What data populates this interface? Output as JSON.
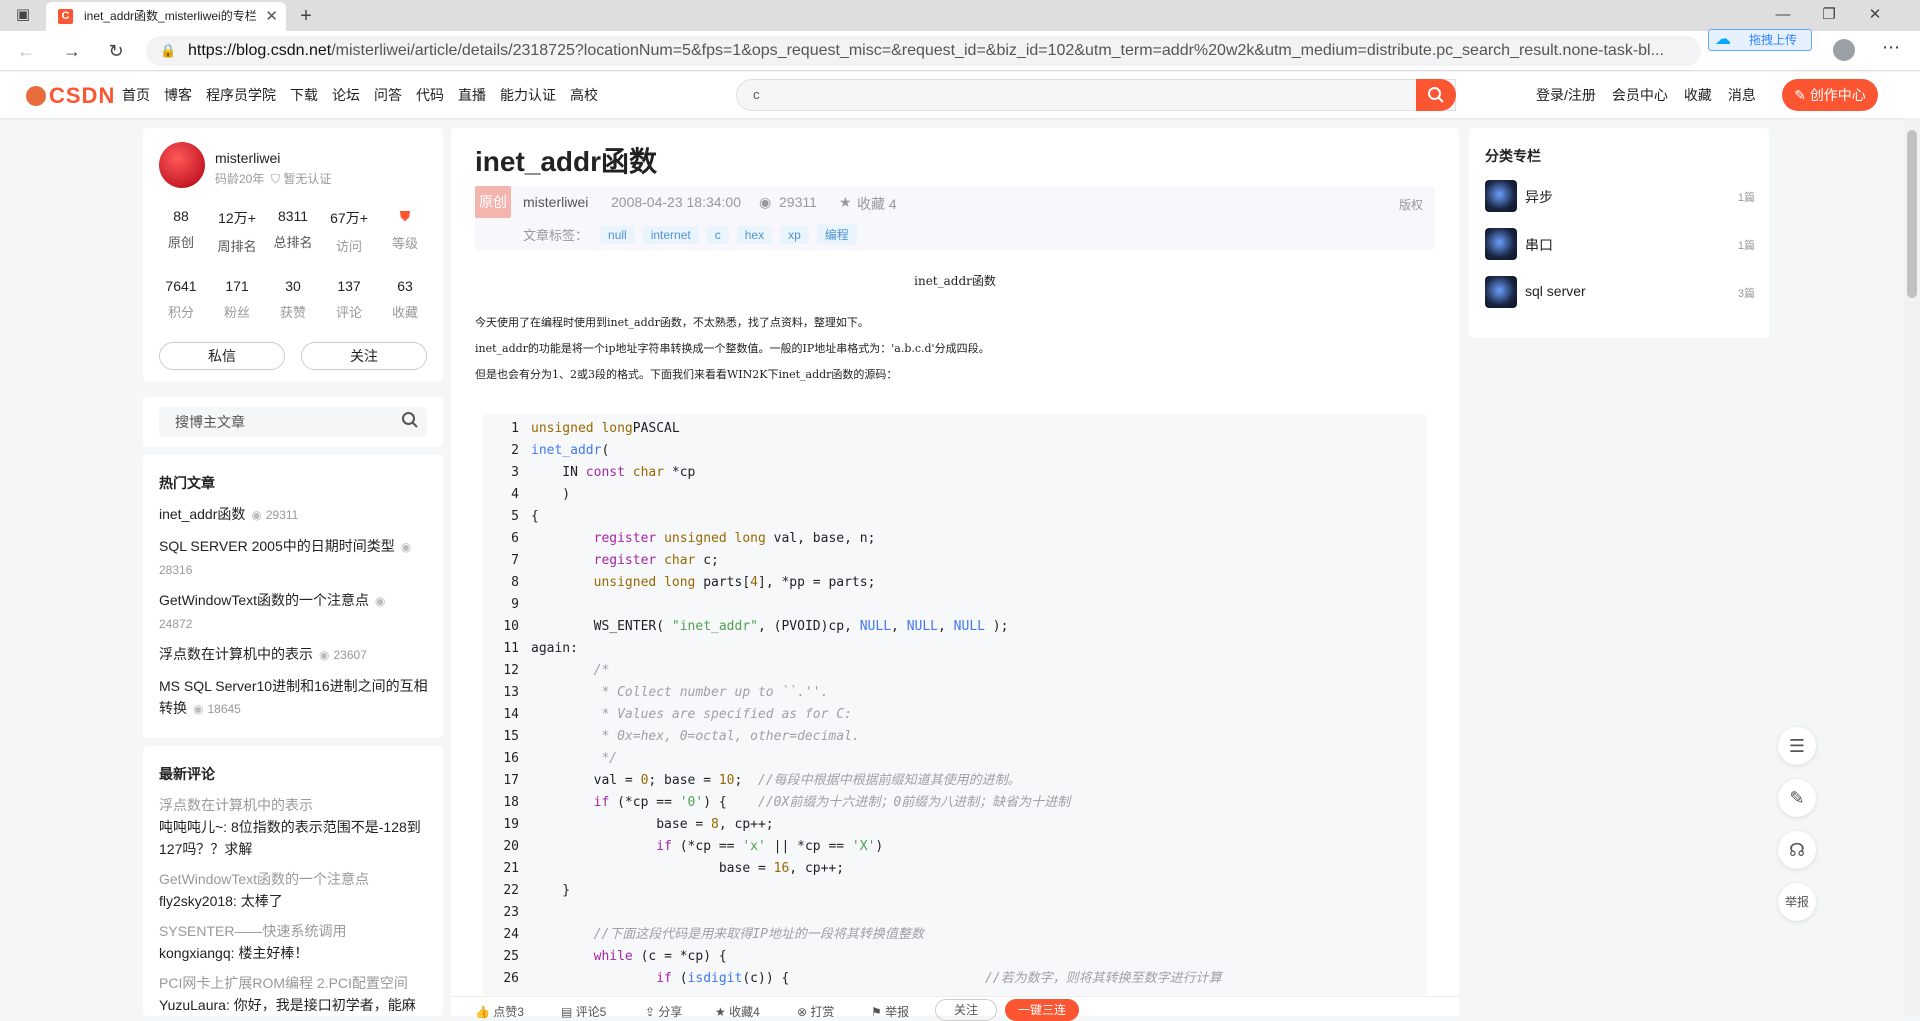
{
  "browser": {
    "tab_title": "inet_addr函数_misterliwei的专栏",
    "url_host": "https://blog.csdn.net",
    "url_rest": "/misterliwei/article/details/2318725?locationNum=5&fps=1&ops_request_misc=&request_id=&biz_id=102&utm_term=addr%20w2k&utm_medium=distribute.pc_search_result.none-task-bl...",
    "extension_label": "拖拽上传"
  },
  "header": {
    "logo": "CSDN",
    "nav": [
      "首页",
      "博客",
      "程序员学院",
      "下载",
      "论坛",
      "问答",
      "代码",
      "直播",
      "能力认证",
      "高校"
    ],
    "search_value": "c",
    "user_nav": [
      "登录/注册",
      "会员中心",
      "收藏",
      "消息"
    ],
    "create_label": "创作中心"
  },
  "profile": {
    "name": "misterliwei",
    "age": "码龄20年",
    "cert": "暂无认证",
    "stats1": [
      {
        "v": "88",
        "l": "原创"
      },
      {
        "v": "12万+",
        "l": "周排名"
      },
      {
        "v": "8311",
        "l": "总排名"
      },
      {
        "v": "67万+",
        "l": "访问"
      },
      {
        "v": "",
        "l": "等级"
      }
    ],
    "stats2": [
      {
        "v": "7641",
        "l": "积分"
      },
      {
        "v": "171",
        "l": "粉丝"
      },
      {
        "v": "30",
        "l": "获赞"
      },
      {
        "v": "137",
        "l": "评论"
      },
      {
        "v": "63",
        "l": "收藏"
      }
    ],
    "msg_label": "私信",
    "follow_label": "关注"
  },
  "sidebar_search": {
    "placeholder": "搜博主文章"
  },
  "hot": {
    "title": "热门文章",
    "items": [
      {
        "t": "inet_addr函数",
        "c": "29311"
      },
      {
        "t": "SQL SERVER 2005中的日期时间类型",
        "c": "28316"
      },
      {
        "t": "GetWindowText函数的一个注意点",
        "c": "24872"
      },
      {
        "t": "浮点数在计算机中的表示",
        "c": "23607"
      },
      {
        "t": "MS SQL Server10进制和16进制之间的互相转换",
        "c": "18645"
      }
    ]
  },
  "latest": {
    "title": "最新评论",
    "items": [
      {
        "t": "浮点数在计算机中的表示",
        "u": "吨吨吨儿~: 8位指数的表示范围不是-128到127吗？？求解"
      },
      {
        "t": "GetWindowText函数的一个注意点",
        "u": "fly2sky2018: 太棒了"
      },
      {
        "t": "SYSENTER——快速系统调用",
        "u": "kongxiangq: 楼主好棒！"
      },
      {
        "t": "PCI网卡上扩展ROM编程 2.PCI配置空间",
        "u": "YuzuLaura: 你好，我是接口初学者，能麻"
      }
    ]
  },
  "article": {
    "title": "inet_addr函数",
    "badge": "原创",
    "author": "misterliwei",
    "date": "2008-04-23 18:34:00",
    "views": "29311",
    "fav": "收藏 4",
    "copyright": "版权",
    "tags_label": "文章标签：",
    "tags": [
      "null",
      "internet",
      "c",
      "hex",
      "xp",
      "编程"
    ],
    "content_title": "inet_addr函数",
    "paras": [
      "今天使用了在编程时使用到inet_addr函数，不太熟悉，找了点资料，整理如下。",
      "inet_addr的功能是将一个ip地址字符串转换成一个整数值。一般的IP地址串格式为：'a.b.c.d'分成四段。",
      "但是也会有分为1、2或3段的格式。下面我们来看看WIN2K下inet_addr函数的源码："
    ]
  },
  "code_lines": [
    [
      [
        "ty",
        "unsigned long"
      ],
      [
        "",
        "PASCAL"
      ]
    ],
    [
      [
        "fn",
        "inet_addr"
      ],
      [
        "",
        "("
      ]
    ],
    [
      [
        "",
        "    IN "
      ],
      [
        "kw",
        "const"
      ],
      [
        "",
        ""
      ],
      [
        "ty",
        " char"
      ],
      [
        "",
        " *cp"
      ]
    ],
    [
      [
        "",
        "    )"
      ]
    ],
    [
      [
        "",
        "{"
      ]
    ],
    [
      [
        "",
        "        "
      ],
      [
        "kw",
        "register"
      ],
      [
        "ty",
        " unsigned long"
      ],
      [
        "",
        " val, base, n;"
      ]
    ],
    [
      [
        "",
        "        "
      ],
      [
        "kw",
        "register"
      ],
      [
        "ty",
        " char"
      ],
      [
        "",
        " c;"
      ]
    ],
    [
      [
        "",
        "        "
      ],
      [
        "ty",
        "unsigned long"
      ],
      [
        "",
        " parts["
      ],
      [
        "num",
        "4"
      ],
      [
        "",
        "], *pp = parts;"
      ]
    ],
    [
      [
        "",
        ""
      ]
    ],
    [
      [
        "",
        "        WS_ENTER( "
      ],
      [
        "str",
        "\"inet_addr\""
      ],
      [
        "",
        ", (PVOID)cp, "
      ],
      [
        "mac",
        "NULL"
      ],
      [
        "",
        ", "
      ],
      [
        "mac",
        "NULL"
      ],
      [
        "",
        ", "
      ],
      [
        "mac",
        "NULL"
      ],
      [
        "",
        " );"
      ]
    ],
    [
      [
        "",
        "again:"
      ]
    ],
    [
      [
        "cm",
        "        /*"
      ]
    ],
    [
      [
        "cm",
        "         * Collect number up to ``.''."
      ]
    ],
    [
      [
        "cm",
        "         * Values are specified as for C:"
      ]
    ],
    [
      [
        "cm",
        "         * 0x=hex, 0=octal, other=decimal."
      ]
    ],
    [
      [
        "cm",
        "         */"
      ]
    ],
    [
      [
        "",
        "        val = "
      ],
      [
        "num",
        "0"
      ],
      [
        "",
        "; base = "
      ],
      [
        "num",
        "10"
      ],
      [
        "",
        ";  "
      ],
      [
        "cm",
        "//每段中根据中根据前缀知道其使用的进制。"
      ]
    ],
    [
      [
        "",
        "        "
      ],
      [
        "kw",
        "if"
      ],
      [
        "",
        " (*cp == "
      ],
      [
        "str",
        "'0'"
      ],
      [
        "",
        ") {    "
      ],
      [
        "cm",
        "//0X前缀为十六进制；0前缀为八进制；缺省为十进制"
      ]
    ],
    [
      [
        "",
        "                base = "
      ],
      [
        "num",
        "8"
      ],
      [
        "",
        ", cp++;"
      ]
    ],
    [
      [
        "",
        "                "
      ],
      [
        "kw",
        "if"
      ],
      [
        "",
        " (*cp == "
      ],
      [
        "str",
        "'x'"
      ],
      [
        "",
        " || *cp == "
      ],
      [
        "str",
        "'X'"
      ],
      [
        "",
        ")"
      ]
    ],
    [
      [
        "",
        "                        base = "
      ],
      [
        "num",
        "16"
      ],
      [
        "",
        ", cp++;"
      ]
    ],
    [
      [
        "",
        "    }"
      ]
    ],
    [
      [
        "",
        ""
      ]
    ],
    [
      [
        "cm",
        "        //下面这段代码是用来取得IP地址的一段将其转换值整数"
      ]
    ],
    [
      [
        "",
        "        "
      ],
      [
        "kw",
        "while"
      ],
      [
        "",
        " (c = *cp) {"
      ]
    ],
    [
      [
        "",
        "                "
      ],
      [
        "kw",
        "if"
      ],
      [
        "",
        " ("
      ],
      [
        "fn",
        "isdigit"
      ],
      [
        "",
        "(c)) {                         "
      ],
      [
        "cm",
        "//若为数字，则将其转换至数字进行计算"
      ]
    ]
  ],
  "bottom_bar": [
    "点赞3",
    "评论5",
    "分享",
    "收藏4",
    "打赏",
    "举报"
  ],
  "bottom_follow": "关注",
  "bottom_triple": "一键三连",
  "categories": {
    "title": "分类专栏",
    "items": [
      {
        "n": "异步",
        "c": "1篇"
      },
      {
        "n": "串口",
        "c": "1篇"
      },
      {
        "n": "sql server",
        "c": "3篇"
      }
    ]
  },
  "float_report": "举报"
}
